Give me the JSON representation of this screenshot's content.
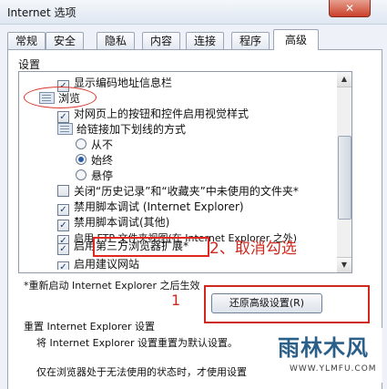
{
  "window": {
    "title": "Internet 选项",
    "close_glyph": "✕"
  },
  "tabs": [
    {
      "label": "常规"
    },
    {
      "label": "安全"
    },
    {
      "label": "隐私"
    },
    {
      "label": "内容"
    },
    {
      "label": "连接"
    },
    {
      "label": "程序"
    },
    {
      "label": "高级",
      "active": true
    }
  ],
  "settings": {
    "label": "设置",
    "items": [
      {
        "type": "checkbox",
        "checked": true,
        "label": "显示编码地址信息栏"
      },
      {
        "type": "category",
        "label": "浏览"
      },
      {
        "type": "checkbox",
        "checked": true,
        "label": "对网页上的按钮和控件启用视觉样式"
      },
      {
        "type": "category",
        "label": "给链接加下划线的方式"
      },
      {
        "type": "radio",
        "checked": false,
        "label": "从不"
      },
      {
        "type": "radio",
        "checked": true,
        "label": "始终"
      },
      {
        "type": "radio",
        "checked": false,
        "label": "悬停"
      },
      {
        "type": "checkbox",
        "checked": false,
        "label": "关闭“历史记录”和“收藏夹”中未使用的文件夹*"
      },
      {
        "type": "checkbox",
        "checked": true,
        "label": "禁用脚本调试 (Internet Explorer)"
      },
      {
        "type": "checkbox",
        "checked": true,
        "label": "禁用脚本调试(其他)"
      },
      {
        "type": "checkbox",
        "checked": true,
        "label": "启用 FTP 文件夹视图(在 Internet Explorer 之外)"
      },
      {
        "type": "checkbox",
        "checked": true,
        "label": "启用第三方浏览器扩展*"
      },
      {
        "type": "checkbox",
        "checked": true,
        "label": "启用建议网站"
      }
    ]
  },
  "annotations": {
    "step2": "2、取消勾选",
    "step1": "1"
  },
  "restart_note": "*重新启动 Internet Explorer 之后生效",
  "restore_button": "还原高级设置(R)",
  "reset": {
    "title": "重置 Internet Explorer 设置",
    "desc": "将 Internet Explorer 设置重置为默认设置。",
    "desc2": "仅在浏览器处于无法使用的状态时，才使用设置"
  },
  "watermark": {
    "main": "雨林木风",
    "url": "WWW.YLMFU.COM"
  },
  "colors": {
    "annotation_red": "#d0281f",
    "accent": "#2a5ca8"
  }
}
